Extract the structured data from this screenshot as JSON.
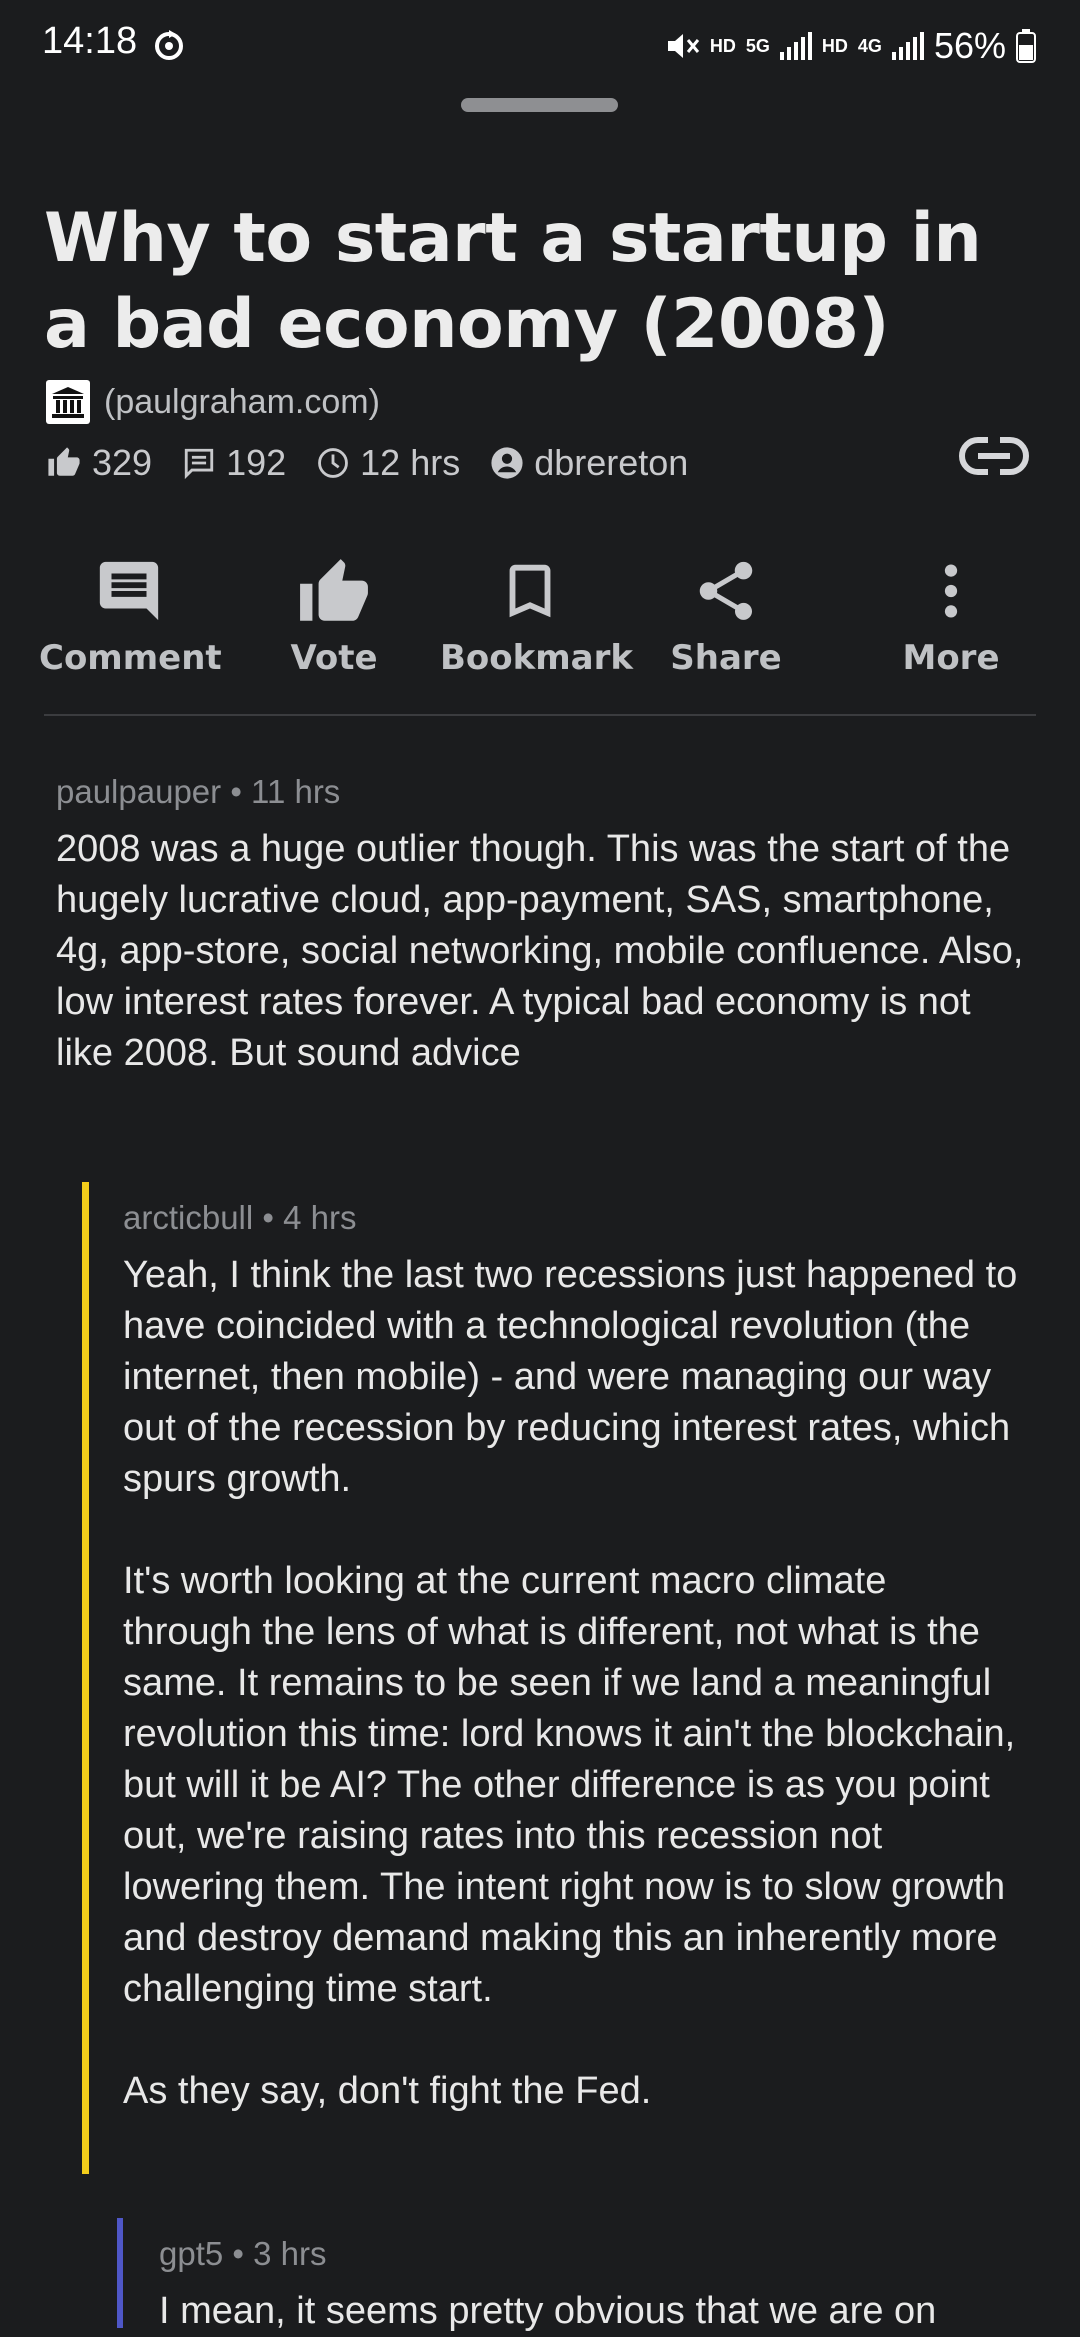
{
  "status_bar": {
    "time": "14:18",
    "hd1": "HD",
    "net1": "5G",
    "hd2": "HD",
    "net2": "4G",
    "battery": "56%"
  },
  "story": {
    "title": "Why to start a startup in a bad economy (2008)",
    "domain": "(paulgraham.com)",
    "points": "329",
    "comments": "192",
    "age": "12 hrs",
    "author": "dbrereton"
  },
  "actions": {
    "comment": "Comment",
    "vote": "Vote",
    "bookmark": "Bookmark",
    "share": "Share",
    "more": "More"
  },
  "comments": [
    {
      "meta": "paulpauper • 11 hrs",
      "paragraphs": [
        "2008 was a huge outlier though. This was the start of the hugely lucrative cloud, app-payment, SAS, smartphone, 4g, app-store, social networking, mobile confluence. Also, low interest rates forever. A typical bad economy is not like 2008. But sound advice"
      ]
    },
    {
      "meta": "arcticbull • 4 hrs",
      "accent": "#f3cd1b",
      "paragraphs": [
        "Yeah, I think the last two recessions just happened to have coincided with a technological revolution (the internet, then mobile) - and were managing our way out of the recession by reducing interest rates, which spurs growth.",
        "It's worth looking at the current macro climate through the lens of what is different, not what is the same. It remains to be seen if we land a meaningful revolution this time: lord knows it ain't the blockchain, but will it be AI? The other difference is as you point out, we're raising rates into this recession not lowering them. The intent right now is to slow growth and destroy demand making this an inherently more challenging time start.",
        "As they say, don't fight the Fed."
      ]
    },
    {
      "meta": "gpt5 • 3 hrs",
      "accent": "#4f57c7",
      "paragraphs": [
        "I mean, it seems pretty obvious that we are on"
      ]
    }
  ],
  "icons": {
    "status": [
      "sync-icon",
      "mute-icon",
      "signal-icon",
      "battery-icon"
    ],
    "meta": [
      "thumb-up-icon",
      "comment-count-icon",
      "clock-icon",
      "user-icon",
      "link-icon"
    ],
    "actions": [
      "comment-icon",
      "vote-icon",
      "bookmark-icon",
      "share-icon",
      "more-vert-icon"
    ]
  }
}
